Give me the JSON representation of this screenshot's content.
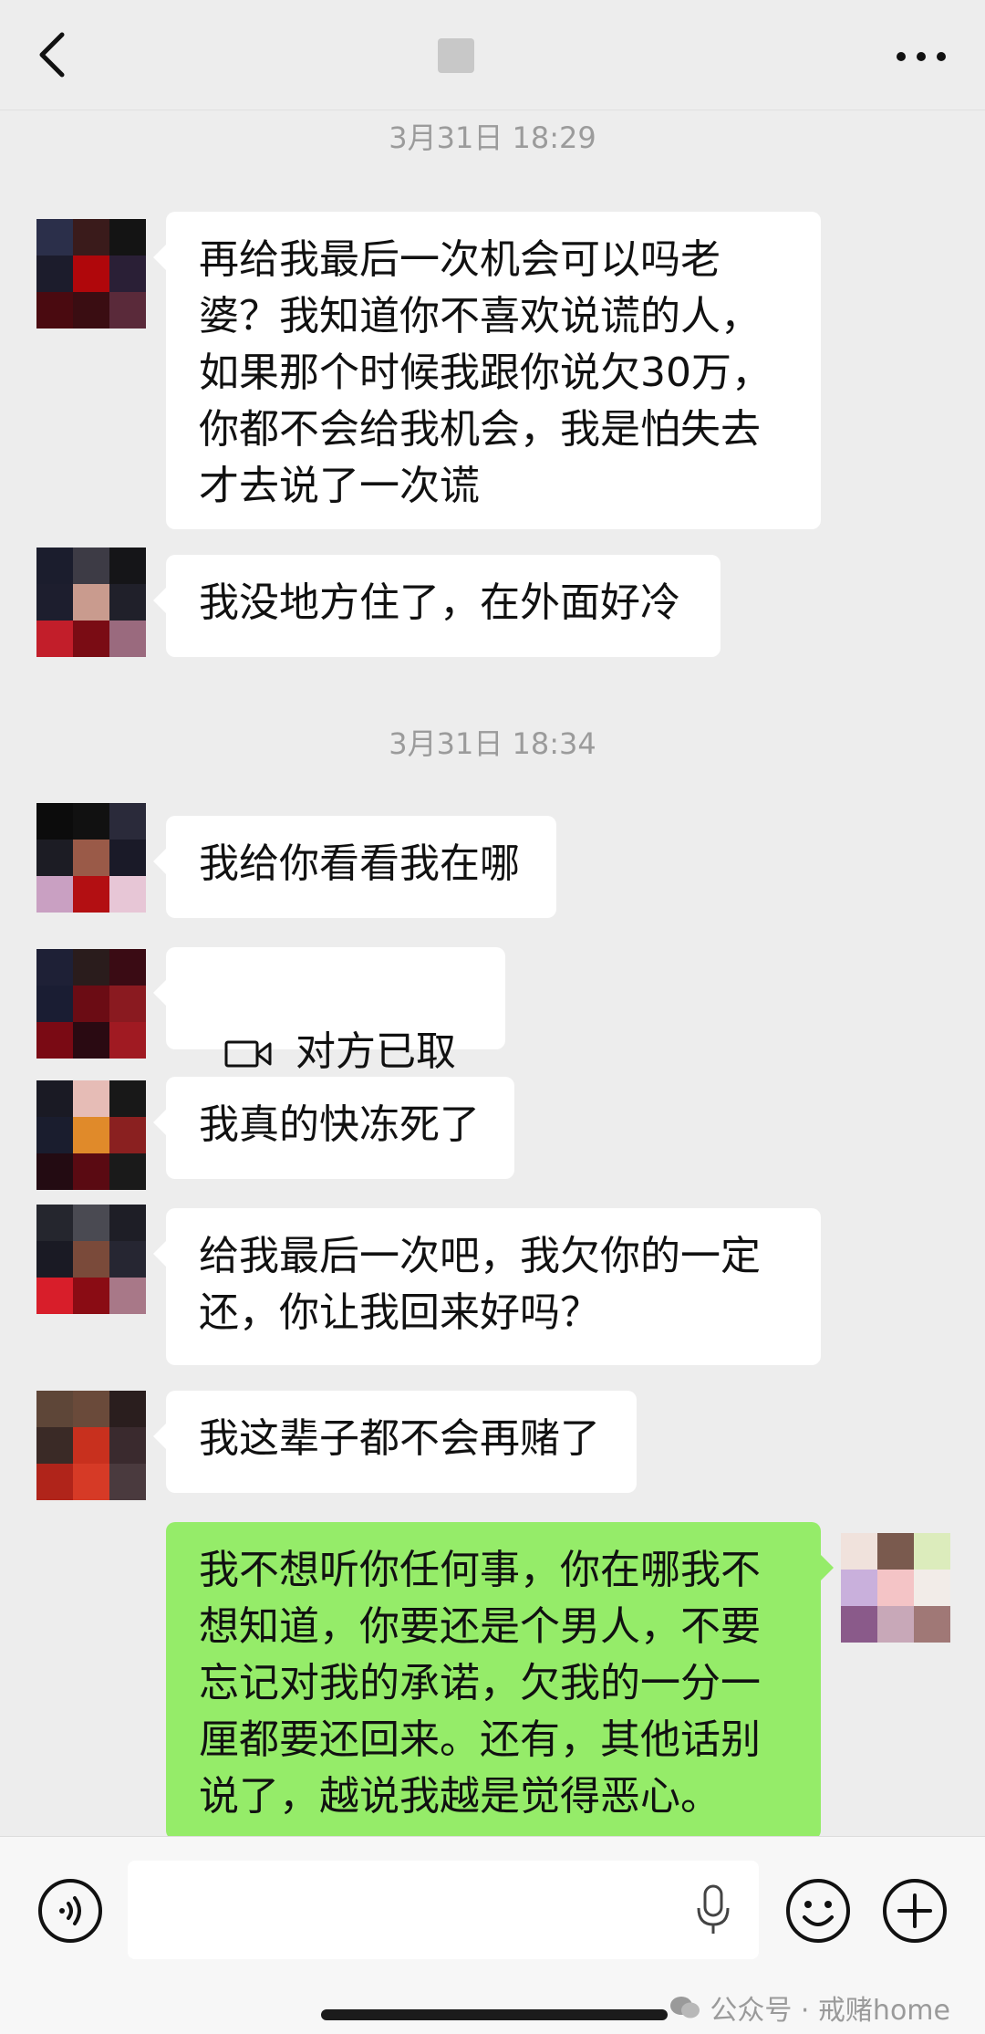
{
  "header": {
    "back_icon": "chevron-left-icon",
    "more_icon": "more-dots-icon"
  },
  "timestamps": [
    "3月31日 18:29",
    "3月31日 18:34"
  ],
  "messages": [
    {
      "text": "再给我最后一次机会可以吗老\n婆？我知道你不喜欢说谎的人，\n如果那个时候我跟你说欠30万，\n你都不会给我机会，我是怕失去\n才去说了一次谎"
    },
    {
      "text": "我没地方住了，在外面好冷"
    },
    {
      "text": "我给你看看我在哪"
    },
    {
      "text": "对方已取消",
      "icon": "video-call-icon"
    },
    {
      "text": "我真的快冻死了"
    },
    {
      "text": "给我最后一次吧，我欠你的一定\n还，你让我回来好吗？"
    },
    {
      "text": "我这辈子都不会再赌了"
    },
    {
      "text": "我不想听你任何事，你在哪我不\n想知道，你要还是个男人，不要\n忘记对我的承诺，欠我的一分一\n厘都要还回来。还有，其他话别\n说了，越说我越是觉得恶心。",
      "from": "me"
    }
  ],
  "input_bar": {
    "voice_icon": "voice-icon",
    "mic_icon": "microphone-icon",
    "emoji_icon": "emoji-icon",
    "plus_icon": "plus-icon"
  },
  "watermark": "公众号 · 戒赌home",
  "colors": {
    "background": "#ededed",
    "bubble_other": "#ffffff",
    "bubble_me": "#95ec69"
  }
}
